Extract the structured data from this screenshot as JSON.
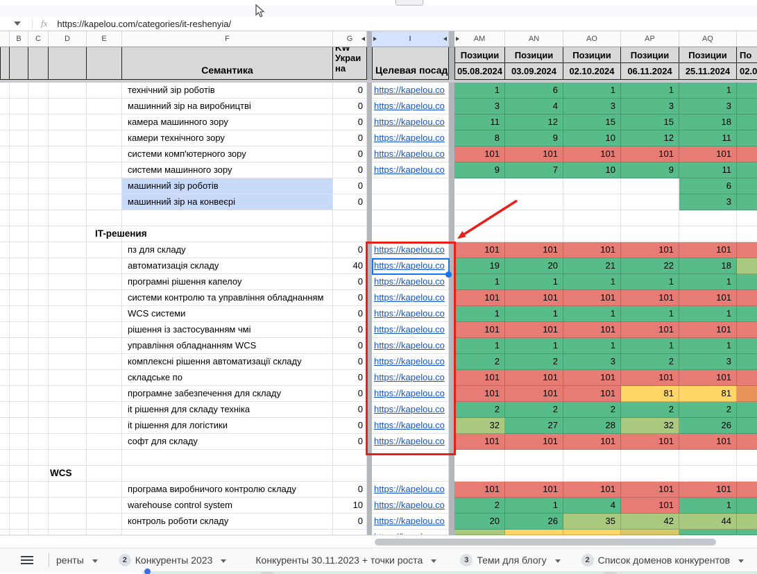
{
  "formula_bar": {
    "fx_label": "fx",
    "value": "https://kapelou.com/categories/it-reshenyia/"
  },
  "columns": {
    "letters": [
      "B",
      "C",
      "D",
      "E",
      "F",
      "G",
      "I",
      "AM",
      "AN",
      "AO",
      "AP",
      "AQ"
    ]
  },
  "headers": {
    "semantics": "Семантика",
    "kw_lines": [
      "KW",
      "Украи",
      "на"
    ],
    "target": "Целевая посад",
    "positions_label": "Позиции",
    "dates": [
      "05.08.2024",
      "03.09.2024",
      "02.10.2024",
      "06.11.2024",
      "25.11.2024"
    ],
    "partial": {
      "label": "По",
      "date": "02.0"
    }
  },
  "colors": {
    "green": "#57BB8A",
    "light_green": "#A9C97F",
    "yellow": "#FFD666",
    "olive_yellow": "#D9C869",
    "orange": "#E8935C",
    "red": "#E67C73",
    "highlight_blue": "#C9DAF8",
    "selection_blue": "#1A73E8",
    "annotation_red": "#E8201A",
    "link_blue": "#1155CC",
    "header_grey": "#D9D9D9"
  },
  "grid": {
    "url_text": "https://kapelou.co",
    "rows": [
      {
        "keyword": "технічний зір роботів",
        "kw_val": "0",
        "link": true,
        "pos": [
          [
            "1",
            "g"
          ],
          [
            "6",
            "g"
          ],
          [
            "1",
            "g"
          ],
          [
            "1",
            "g"
          ],
          [
            "1",
            "g"
          ]
        ],
        "ar": "g"
      },
      {
        "keyword": "машинний зір на виробництві",
        "kw_val": "0",
        "link": true,
        "pos": [
          [
            "3",
            "g"
          ],
          [
            "4",
            "g"
          ],
          [
            "3",
            "g"
          ],
          [
            "3",
            "g"
          ],
          [
            "3",
            "g"
          ]
        ],
        "ar": "g"
      },
      {
        "keyword": "камера машинного зору",
        "kw_val": "0",
        "link": true,
        "pos": [
          [
            "11",
            "g"
          ],
          [
            "12",
            "g"
          ],
          [
            "15",
            "g"
          ],
          [
            "15",
            "g"
          ],
          [
            "18",
            "g"
          ]
        ],
        "ar": "g"
      },
      {
        "keyword": "камери технічного зору",
        "kw_val": "0",
        "link": true,
        "pos": [
          [
            "8",
            "g"
          ],
          [
            "9",
            "g"
          ],
          [
            "10",
            "g"
          ],
          [
            "12",
            "g"
          ],
          [
            "11",
            "g"
          ]
        ],
        "ar": "g"
      },
      {
        "keyword": "системи комп'ютерного зору",
        "kw_val": "0",
        "link": true,
        "pos": [
          [
            "101",
            "r"
          ],
          [
            "101",
            "r"
          ],
          [
            "101",
            "r"
          ],
          [
            "101",
            "r"
          ],
          [
            "101",
            "r"
          ]
        ],
        "ar": "r"
      },
      {
        "keyword": "системи машинного зору",
        "kw_val": "0",
        "link": true,
        "pos": [
          [
            "9",
            "g"
          ],
          [
            "7",
            "g"
          ],
          [
            "10",
            "g"
          ],
          [
            "9",
            "g"
          ],
          [
            "11",
            "g"
          ]
        ],
        "ar": "g"
      },
      {
        "keyword": "машинний зір роботів",
        "kw_val": "0",
        "hl": true,
        "pos": [
          null,
          null,
          null,
          null,
          [
            "6",
            "g"
          ]
        ],
        "ar": "g"
      },
      {
        "keyword": "машинний зір на конвеєрі",
        "kw_val": "0",
        "hl": true,
        "pos": [
          null,
          null,
          null,
          null,
          [
            "3",
            "g"
          ]
        ],
        "ar": "g"
      },
      {
        "blank": true
      },
      {
        "section": "IT-решения",
        "indent": 137
      },
      {
        "keyword": "пз для складу",
        "kw_val": "0",
        "link": true,
        "pos": [
          [
            "101",
            "r"
          ],
          [
            "101",
            "r"
          ],
          [
            "101",
            "r"
          ],
          [
            "101",
            "r"
          ],
          [
            "101",
            "r"
          ]
        ],
        "ar": "r"
      },
      {
        "keyword": "автоматизація складу",
        "kw_val": "40",
        "link": true,
        "selected": true,
        "pos": [
          [
            "19",
            "g"
          ],
          [
            "20",
            "g"
          ],
          [
            "21",
            "g"
          ],
          [
            "22",
            "g"
          ],
          [
            "18",
            "g"
          ]
        ],
        "ar": "lg"
      },
      {
        "keyword": "програмні рішення капелоу",
        "kw_val": "0",
        "link": true,
        "pos": [
          [
            "1",
            "g"
          ],
          [
            "1",
            "g"
          ],
          [
            "1",
            "g"
          ],
          [
            "1",
            "g"
          ],
          [
            "1",
            "g"
          ]
        ],
        "ar": "g"
      },
      {
        "keyword": "системи контролю та управління обладнанням",
        "kw_val": "0",
        "link": true,
        "pos": [
          [
            "101",
            "r"
          ],
          [
            "101",
            "r"
          ],
          [
            "101",
            "r"
          ],
          [
            "101",
            "r"
          ],
          [
            "101",
            "r"
          ]
        ],
        "ar": "r"
      },
      {
        "keyword": "WCS системи",
        "kw_val": "0",
        "link": true,
        "pos": [
          [
            "1",
            "g"
          ],
          [
            "1",
            "g"
          ],
          [
            "1",
            "g"
          ],
          [
            "1",
            "g"
          ],
          [
            "1",
            "g"
          ]
        ],
        "ar": "g"
      },
      {
        "keyword": "рішення із застосуванням чмі",
        "kw_val": "0",
        "link": true,
        "pos": [
          [
            "101",
            "r"
          ],
          [
            "101",
            "r"
          ],
          [
            "101",
            "r"
          ],
          [
            "101",
            "r"
          ],
          [
            "101",
            "r"
          ]
        ],
        "ar": "r"
      },
      {
        "keyword": "управління обладнанням WCS",
        "kw_val": "0",
        "link": true,
        "pos": [
          [
            "1",
            "g"
          ],
          [
            "1",
            "g"
          ],
          [
            "1",
            "g"
          ],
          [
            "1",
            "g"
          ],
          [
            "1",
            "g"
          ]
        ],
        "ar": "g"
      },
      {
        "keyword": "комплексні рішення автоматизації складу",
        "kw_val": "0",
        "link": true,
        "pos": [
          [
            "2",
            "g"
          ],
          [
            "2",
            "g"
          ],
          [
            "3",
            "g"
          ],
          [
            "2",
            "g"
          ],
          [
            "3",
            "g"
          ]
        ],
        "ar": "g"
      },
      {
        "keyword": "складське по",
        "kw_val": "0",
        "link": true,
        "pos": [
          [
            "101",
            "r"
          ],
          [
            "101",
            "r"
          ],
          [
            "101",
            "r"
          ],
          [
            "101",
            "r"
          ],
          [
            "101",
            "r"
          ]
        ],
        "ar": "r"
      },
      {
        "keyword": "програмне забезпечення для складу",
        "kw_val": "0",
        "link": true,
        "pos": [
          [
            "101",
            "r"
          ],
          [
            "101",
            "r"
          ],
          [
            "101",
            "r"
          ],
          [
            "81",
            "y"
          ],
          [
            "81",
            "y"
          ]
        ],
        "ar": "o"
      },
      {
        "keyword": "it рішення для складу техніка",
        "kw_val": "0",
        "link": true,
        "pos": [
          [
            "2",
            "g"
          ],
          [
            "2",
            "g"
          ],
          [
            "2",
            "g"
          ],
          [
            "2",
            "g"
          ],
          [
            "2",
            "g"
          ]
        ],
        "ar": "g"
      },
      {
        "keyword": "it рішення для логістики",
        "kw_val": "0",
        "link": true,
        "pos": [
          [
            "32",
            "lg"
          ],
          [
            "27",
            "g"
          ],
          [
            "28",
            "g"
          ],
          [
            "32",
            "lg"
          ],
          [
            "26",
            "g"
          ]
        ],
        "ar": "g"
      },
      {
        "keyword": "софт для складу",
        "kw_val": "0",
        "link": true,
        "pos": [
          [
            "101",
            "r"
          ],
          [
            "101",
            "r"
          ],
          [
            "101",
            "r"
          ],
          [
            "101",
            "r"
          ],
          [
            "101",
            "r"
          ]
        ],
        "ar": "r"
      },
      {
        "blank": true
      },
      {
        "section": "WCS",
        "indent": 72
      },
      {
        "keyword": "програма виробничого контролю складу",
        "kw_val": "0",
        "link": true,
        "pos": [
          [
            "101",
            "r"
          ],
          [
            "101",
            "r"
          ],
          [
            "101",
            "r"
          ],
          [
            "101",
            "r"
          ],
          [
            "101",
            "r"
          ]
        ],
        "ar": "r"
      },
      {
        "keyword": "warehouse control system",
        "kw_val": "10",
        "link": true,
        "pos": [
          [
            "2",
            "g"
          ],
          [
            "1",
            "g"
          ],
          [
            "4",
            "g"
          ],
          [
            "101",
            "r"
          ],
          [
            "1",
            "g"
          ]
        ],
        "ar": "g"
      },
      {
        "keyword": "контроль роботи складу",
        "kw_val": "0",
        "link": true,
        "pos": [
          [
            "20",
            "g"
          ],
          [
            "26",
            "g"
          ],
          [
            "35",
            "lg"
          ],
          [
            "42",
            "lg"
          ],
          [
            "44",
            "lg"
          ]
        ],
        "ar": "lg"
      },
      {
        "partial": true,
        "link": true,
        "pos": [
          [
            "",
            "lg"
          ],
          [
            "",
            "y"
          ],
          [
            "",
            "y"
          ],
          [
            "",
            "oy"
          ],
          [
            "",
            "g"
          ]
        ],
        "ar": "g"
      }
    ]
  },
  "tabs": [
    {
      "label": "ренты"
    },
    {
      "badge": "2",
      "label": "Конкуренты 2023"
    },
    {
      "label": "Конкуренты 30.11.2023 + точки роста"
    },
    {
      "badge": "3",
      "label": "Теми для блогу"
    },
    {
      "badge": "2",
      "label": "Список доменов конкурентов"
    }
  ]
}
